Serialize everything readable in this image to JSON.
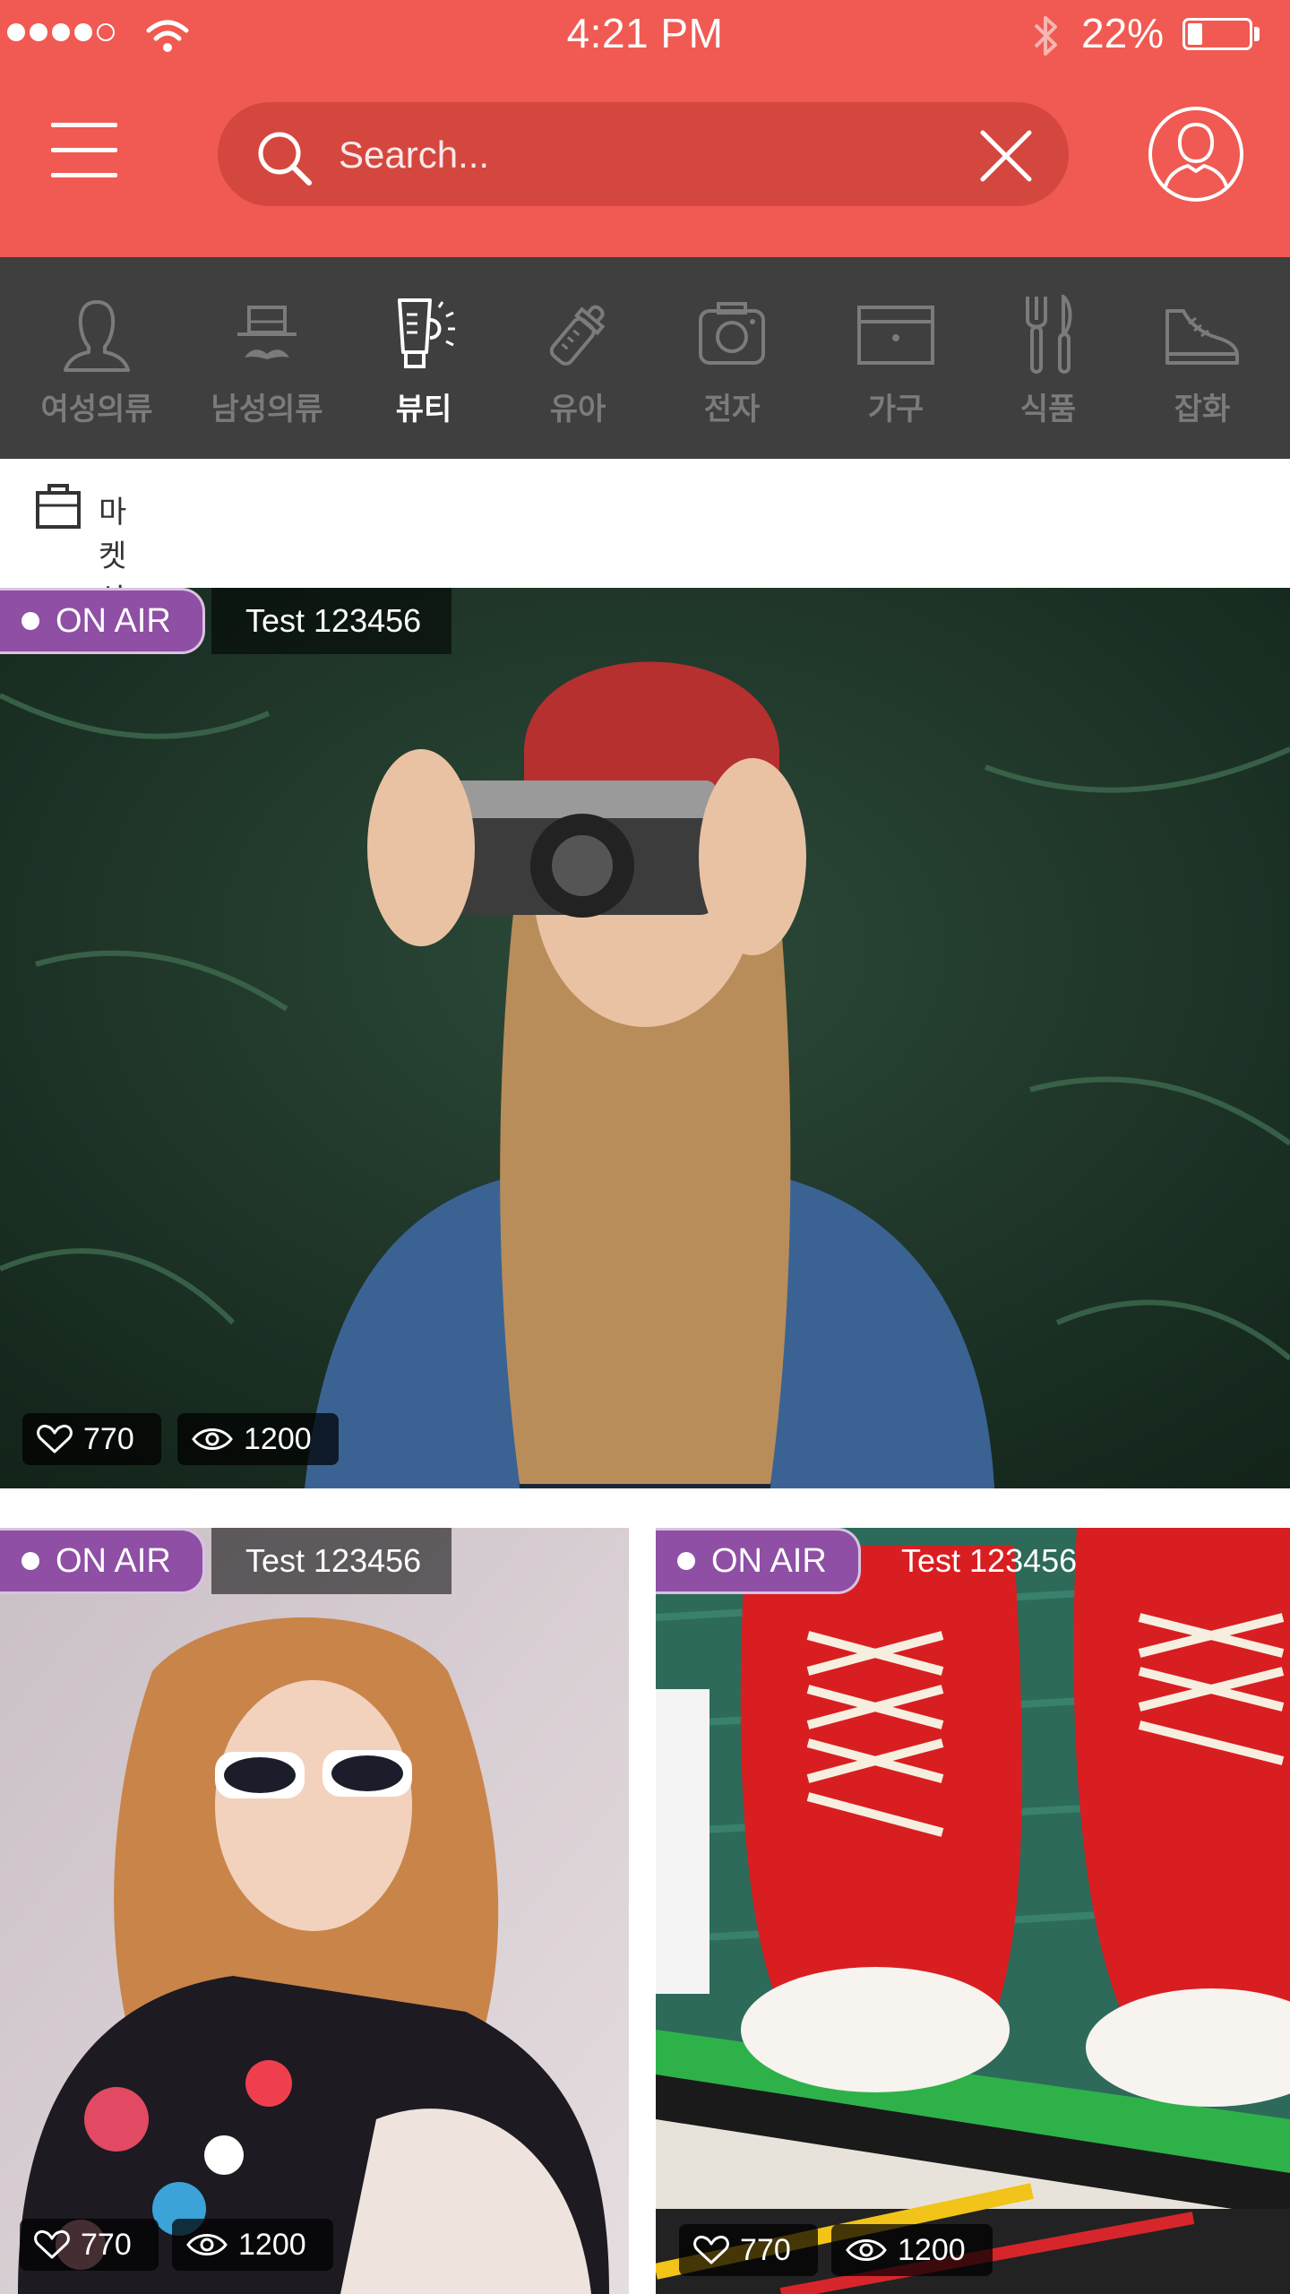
{
  "status_bar": {
    "time": "4:21 PM",
    "battery": "22%",
    "battery_level": 0.22,
    "signal_bars": 4
  },
  "header": {
    "search_placeholder": "Search..."
  },
  "categories": [
    {
      "label": "여성의류",
      "icon": "women-clothing-icon"
    },
    {
      "label": "남성의류",
      "icon": "men-clothing-icon"
    },
    {
      "label": "뷰티",
      "icon": "beauty-icon",
      "active": true
    },
    {
      "label": "유아",
      "icon": "baby-bottle-icon"
    },
    {
      "label": "전자",
      "icon": "camera-icon"
    },
    {
      "label": "가구",
      "icon": "furniture-icon"
    },
    {
      "label": "식품",
      "icon": "fork-knife-icon"
    },
    {
      "label": "잡화",
      "icon": "sneaker-icon"
    }
  ],
  "section": {
    "label": "마켓상품",
    "icon": "shopping-bag-icon"
  },
  "cards": [
    {
      "badge": "ON AIR",
      "title": "Test 123456",
      "likes": "770",
      "views": "1200"
    },
    {
      "badge": "ON AIR",
      "title": "Test 123456",
      "likes": "770",
      "views": "1200"
    },
    {
      "badge": "ON AIR",
      "title": "Test 123456",
      "likes": "770",
      "views": "1200"
    }
  ],
  "colors": {
    "brand": "#f05a52",
    "search_bg": "#d4473f",
    "category_bg": "#3f3f3f",
    "badge": "#8e4fa5"
  }
}
